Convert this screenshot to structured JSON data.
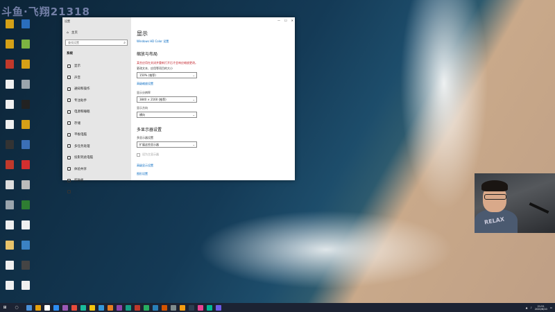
{
  "watermark": "斗鱼·飞翔21318",
  "desktop_icons": [
    {
      "label": "",
      "color": "#d4a017"
    },
    {
      "label": "",
      "color": "#2a6ebd"
    },
    {
      "label": "",
      "color": "#d4a017"
    },
    {
      "label": "",
      "color": "#7cb342"
    },
    {
      "label": "",
      "color": "#c0392b"
    },
    {
      "label": "",
      "color": "#d4a017"
    },
    {
      "label": "",
      "color": "#f0f0f0"
    },
    {
      "label": "",
      "color": "#9aa5ad"
    },
    {
      "label": "",
      "color": "#f0f0f0"
    },
    {
      "label": "",
      "color": "#222"
    },
    {
      "label": "",
      "color": "#f0f0f0"
    },
    {
      "label": "",
      "color": "#d4a017"
    },
    {
      "label": "",
      "color": "#333"
    },
    {
      "label": "",
      "color": "#3b6fb6"
    },
    {
      "label": "",
      "color": "#c0392b"
    },
    {
      "label": "",
      "color": "#d32f2f"
    },
    {
      "label": "",
      "color": "#ddd"
    },
    {
      "label": "",
      "color": "#bbb"
    },
    {
      "label": "",
      "color": "#9aa5ad"
    },
    {
      "label": "",
      "color": "#2e7d32"
    },
    {
      "label": "",
      "color": "#f0f0f0"
    },
    {
      "label": "",
      "color": "#f0f0f0"
    },
    {
      "label": "",
      "color": "#e8c36a"
    },
    {
      "label": "",
      "color": "#3b82c4"
    },
    {
      "label": "",
      "color": "#f0f0f0"
    },
    {
      "label": "",
      "color": "#444"
    },
    {
      "label": "",
      "color": "#f0f0f0"
    },
    {
      "label": "",
      "color": "#f0f0f0"
    }
  ],
  "webcam": {
    "shirt_text": "RELAX"
  },
  "settings": {
    "window_title": "设置",
    "caption": {
      "minimize": "—",
      "maximize": "☐",
      "close": "✕"
    },
    "home": "主页",
    "search_placeholder": "查找设置",
    "section": "系统",
    "nav": [
      "显示",
      "声音",
      "通知和操作",
      "专注助手",
      "电源和睡眠",
      "存储",
      "平板电脑",
      "多任务处理",
      "投影到此电脑",
      "体验共享",
      "剪贴板",
      ""
    ],
    "page_title": "显示",
    "hdr_link": "Windows HD Color 设置",
    "scale_heading": "缩放与布局",
    "warning": "某些应用在关闭并重新打开后才会响应缩放更改。",
    "scale_label": "更改文本、应用等项目的大小",
    "scale_value": "150% (推荐)",
    "advanced_scale_link": "高级缩放设置",
    "resolution_label": "显示分辨率",
    "resolution_value": "3840 × 2160 (推荐)",
    "orientation_label": "显示方向",
    "orientation_value": "横向",
    "multi_heading": "多显示器设置",
    "multi_label": "多显示器设置",
    "multi_value": "扩展这些显示器",
    "main_display_check": "设为主显示器",
    "advanced_display_link": "高级显示设置",
    "graphics_link": "图形设置"
  },
  "taskbar": {
    "apps": [
      "#4a90d9",
      "#e5a00d",
      "#ffffff",
      "#2d8cf0",
      "#9b59b6",
      "#e74c3c",
      "#1abc9c",
      "#f1c40f",
      "#3498db",
      "#e67e22",
      "#8e44ad",
      "#16a085",
      "#c0392b",
      "#27ae60",
      "#2980b9",
      "#d35400",
      "#7f8c8d",
      "#f39c12",
      "#2c3e50",
      "#e84393",
      "#00b894",
      "#6c5ce7"
    ],
    "time": "21:51",
    "date": "2020/6/10"
  }
}
